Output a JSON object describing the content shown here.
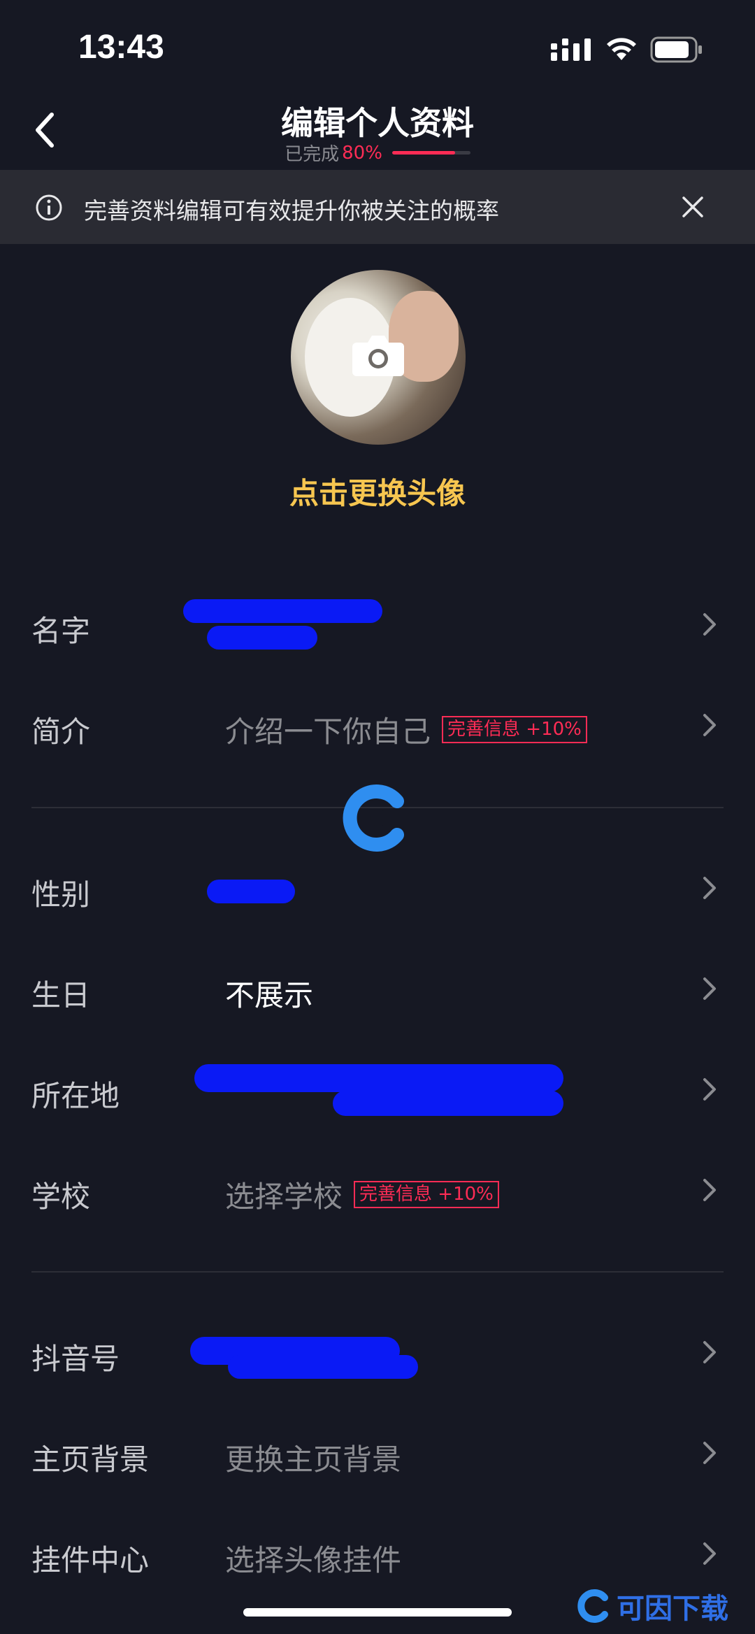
{
  "status_bar": {
    "time": "13:43"
  },
  "header": {
    "title": "编辑个人资料",
    "progress_label": "已完成",
    "progress_value": "80%",
    "progress_fraction": 0.8
  },
  "notice": {
    "text": "完善资料编辑可有效提升你被关注的概率"
  },
  "avatar": {
    "change_label": "点击更换头像"
  },
  "profile_rows": [
    {
      "label": "名字",
      "value": "",
      "badge": ""
    },
    {
      "label": "简介",
      "value": "介绍一下你自己",
      "badge": "完善信息 +10%"
    },
    {
      "label": "性别",
      "value": "",
      "badge": ""
    },
    {
      "label": "生日",
      "value": "不展示",
      "badge": ""
    },
    {
      "label": "所在地",
      "value": "",
      "badge": ""
    },
    {
      "label": "学校",
      "value": "选择学校",
      "badge": "完善信息 +10%"
    },
    {
      "label": "抖音号",
      "value": "",
      "badge": ""
    },
    {
      "label": "主页背景",
      "value": "更换主页背景",
      "badge": ""
    },
    {
      "label": "挂件中心",
      "value": "选择头像挂件",
      "badge": ""
    }
  ],
  "watermark": {
    "brand": "可因下载"
  },
  "colors": {
    "background": "#161823",
    "accent": "#fe2c55",
    "link": "#f7c650"
  }
}
